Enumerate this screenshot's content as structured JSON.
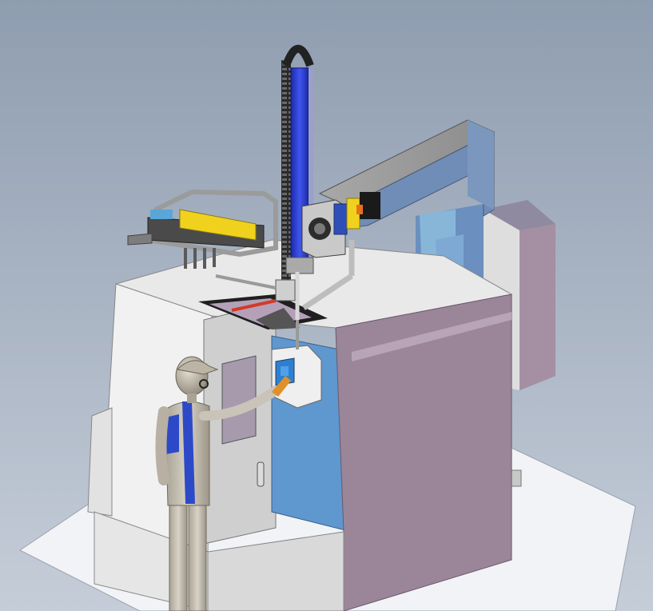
{
  "scene": {
    "colors": {
      "background_top": "#8f9db0",
      "background_bottom": "#c5cdd8",
      "floor_plate": "#f1f3f6",
      "machine_white": "#f2f2f2",
      "machine_side_blue": "#5f97cf",
      "machine_side_mauve": "#9a8599",
      "gantry_gray": "#8f8f8f",
      "axis_blue": "#2e3fd1",
      "gripper_yellow": "#f0d21e",
      "operator_suit": "#c9c3b8",
      "operator_stripe": "#2c4ac8"
    }
  }
}
